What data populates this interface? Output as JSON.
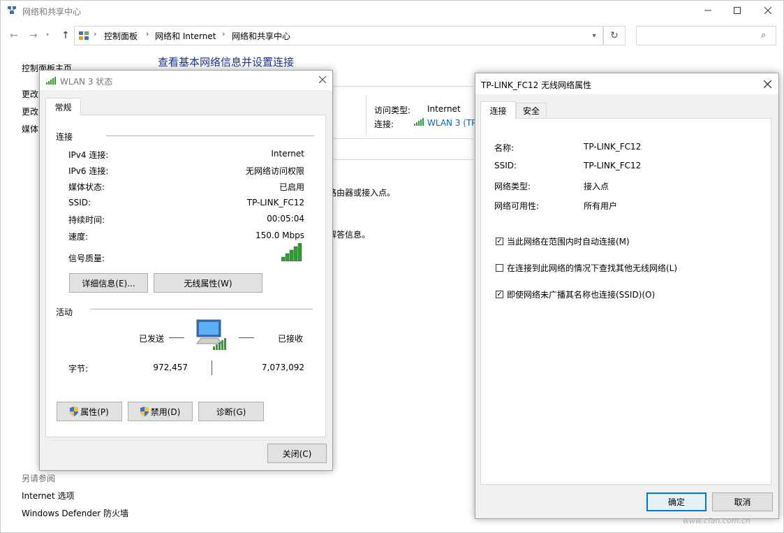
{
  "main_window": {
    "title": "网络和共享中心",
    "breadcrumbs": [
      "控制面板",
      "网络和 Internet",
      "网络和共享中心"
    ],
    "search": {
      "placeholder": ""
    },
    "sidebar": {
      "home": "控制面板主页",
      "link1": "更改",
      "link2": "更改",
      "link3": "媒体"
    },
    "page_title": "查看基本网络信息并设置连接",
    "network": {
      "access_type_label": "访问类型:",
      "access_type_value": "Internet",
      "connection_label": "连接:",
      "connection_value": "WLAN 3 (TP"
    },
    "partial_text1": "路由器或接入点。",
    "partial_text2": "解答信息。",
    "see_also": {
      "heading": "另请参阅",
      "items": [
        "Internet 选项",
        "Windows Defender 防火墙"
      ]
    }
  },
  "wlan_dialog": {
    "title": "WLAN 3 状态",
    "tab": "常规",
    "connection_heading": "连接",
    "rows": [
      {
        "label": "IPv4 连接:",
        "value": "Internet"
      },
      {
        "label": "IPv6 连接:",
        "value": "无网络访问权限"
      },
      {
        "label": "媒体状态:",
        "value": "已启用"
      },
      {
        "label": "SSID:",
        "value": "TP-LINK_FC12"
      },
      {
        "label": "持续时间:",
        "value": "00:05:04"
      },
      {
        "label": "速度:",
        "value": "150.0 Mbps"
      }
    ],
    "signal_label": "信号质量:",
    "details_button": "详细信息(E)...",
    "wireless_props_button": "无线属性(W)",
    "activity_heading": "活动",
    "sent_label": "已发送",
    "received_label": "已接收",
    "bytes_label": "字节:",
    "bytes_sent": "972,457",
    "bytes_received": "7,073,092",
    "properties_button": "属性(P)",
    "disable_button": "禁用(D)",
    "diagnose_button": "诊断(G)",
    "close_button": "关闭(C)"
  },
  "props_dialog": {
    "title": "TP-LINK_FC12 无线网络属性",
    "tabs": [
      "连接",
      "安全"
    ],
    "rows": [
      {
        "label": "名称:",
        "value": "TP-LINK_FC12"
      },
      {
        "label": "SSID:",
        "value": "TP-LINK_FC12"
      },
      {
        "label": "网络类型:",
        "value": "接入点"
      },
      {
        "label": "网络可用性:",
        "value": "所有用户"
      }
    ],
    "checkboxes": [
      {
        "label": "当此网络在范围内时自动连接(M)",
        "checked": true
      },
      {
        "label": "在连接到此网络的情况下查找其他无线网络(L)",
        "checked": false
      },
      {
        "label": "即使网络未广播其名称也连接(SSID)(O)",
        "checked": true
      }
    ],
    "ok_button": "确定",
    "cancel_button": "取消"
  },
  "watermark": "www.cfan.com.cn",
  "colors": {
    "accent": "#0078d7",
    "link": "#0066cc",
    "title_blue": "#1e3287",
    "signal_green": "#2e9e2e",
    "dialog_bg": "#f0f0f0"
  }
}
